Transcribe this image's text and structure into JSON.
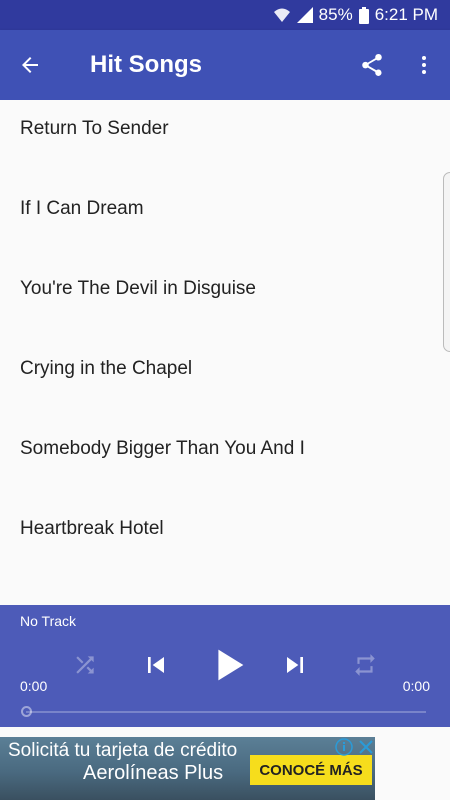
{
  "status_bar": {
    "battery": "85%",
    "time": "6:21 PM",
    "icons": [
      "wifi-icon",
      "signal-icon",
      "battery-icon"
    ]
  },
  "app_bar": {
    "title": "Hit Songs",
    "icons": [
      "back-arrow-icon",
      "share-icon",
      "more-vert-icon"
    ]
  },
  "songs": [
    {
      "title": "Return To Sender"
    },
    {
      "title": "If I Can Dream"
    },
    {
      "title": "You're The Devil in Disguise"
    },
    {
      "title": "Crying in the Chapel"
    },
    {
      "title": "Somebody Bigger Than You And I"
    },
    {
      "title": "Heartbreak Hotel"
    }
  ],
  "player": {
    "track": "No Track",
    "current_time": "0:00",
    "total_time": "0:00",
    "progress": 0,
    "controls": [
      "shuffle-icon",
      "previous-icon",
      "play-icon",
      "next-icon",
      "repeat-icon"
    ]
  },
  "ad": {
    "line1": "Solicitá tu tarjeta de crédito",
    "line2": "Aerolíneas Plus",
    "cta": "CONOCÉ MÁS",
    "icons": [
      "ad-info-icon",
      "ad-close-icon"
    ]
  },
  "colors": {
    "status_bar": "#303a9e",
    "app_bar": "#3f51b5",
    "player": "#4d5bb8",
    "cta": "#f6dd1c"
  }
}
